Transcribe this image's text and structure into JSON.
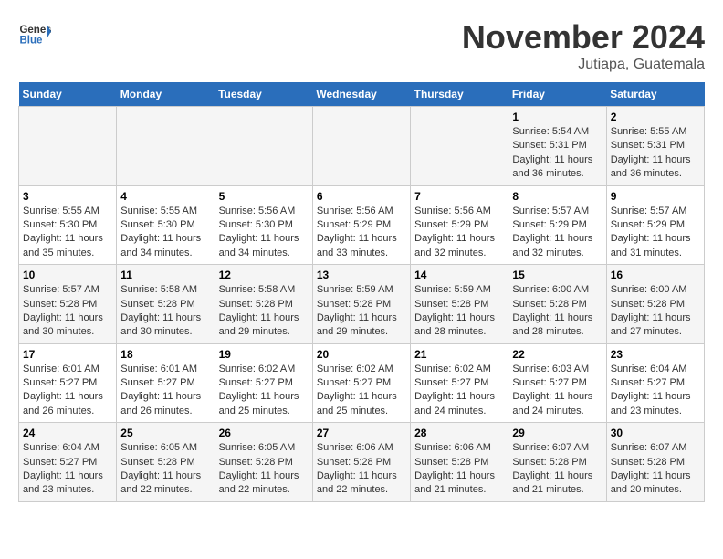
{
  "header": {
    "logo_line1": "General",
    "logo_line2": "Blue",
    "month_title": "November 2024",
    "location": "Jutiapa, Guatemala"
  },
  "weekdays": [
    "Sunday",
    "Monday",
    "Tuesday",
    "Wednesday",
    "Thursday",
    "Friday",
    "Saturday"
  ],
  "weeks": [
    [
      {
        "day": "",
        "info": ""
      },
      {
        "day": "",
        "info": ""
      },
      {
        "day": "",
        "info": ""
      },
      {
        "day": "",
        "info": ""
      },
      {
        "day": "",
        "info": ""
      },
      {
        "day": "1",
        "info": "Sunrise: 5:54 AM\nSunset: 5:31 PM\nDaylight: 11 hours and 36 minutes."
      },
      {
        "day": "2",
        "info": "Sunrise: 5:55 AM\nSunset: 5:31 PM\nDaylight: 11 hours and 36 minutes."
      }
    ],
    [
      {
        "day": "3",
        "info": "Sunrise: 5:55 AM\nSunset: 5:30 PM\nDaylight: 11 hours and 35 minutes."
      },
      {
        "day": "4",
        "info": "Sunrise: 5:55 AM\nSunset: 5:30 PM\nDaylight: 11 hours and 34 minutes."
      },
      {
        "day": "5",
        "info": "Sunrise: 5:56 AM\nSunset: 5:30 PM\nDaylight: 11 hours and 34 minutes."
      },
      {
        "day": "6",
        "info": "Sunrise: 5:56 AM\nSunset: 5:29 PM\nDaylight: 11 hours and 33 minutes."
      },
      {
        "day": "7",
        "info": "Sunrise: 5:56 AM\nSunset: 5:29 PM\nDaylight: 11 hours and 32 minutes."
      },
      {
        "day": "8",
        "info": "Sunrise: 5:57 AM\nSunset: 5:29 PM\nDaylight: 11 hours and 32 minutes."
      },
      {
        "day": "9",
        "info": "Sunrise: 5:57 AM\nSunset: 5:29 PM\nDaylight: 11 hours and 31 minutes."
      }
    ],
    [
      {
        "day": "10",
        "info": "Sunrise: 5:57 AM\nSunset: 5:28 PM\nDaylight: 11 hours and 30 minutes."
      },
      {
        "day": "11",
        "info": "Sunrise: 5:58 AM\nSunset: 5:28 PM\nDaylight: 11 hours and 30 minutes."
      },
      {
        "day": "12",
        "info": "Sunrise: 5:58 AM\nSunset: 5:28 PM\nDaylight: 11 hours and 29 minutes."
      },
      {
        "day": "13",
        "info": "Sunrise: 5:59 AM\nSunset: 5:28 PM\nDaylight: 11 hours and 29 minutes."
      },
      {
        "day": "14",
        "info": "Sunrise: 5:59 AM\nSunset: 5:28 PM\nDaylight: 11 hours and 28 minutes."
      },
      {
        "day": "15",
        "info": "Sunrise: 6:00 AM\nSunset: 5:28 PM\nDaylight: 11 hours and 28 minutes."
      },
      {
        "day": "16",
        "info": "Sunrise: 6:00 AM\nSunset: 5:28 PM\nDaylight: 11 hours and 27 minutes."
      }
    ],
    [
      {
        "day": "17",
        "info": "Sunrise: 6:01 AM\nSunset: 5:27 PM\nDaylight: 11 hours and 26 minutes."
      },
      {
        "day": "18",
        "info": "Sunrise: 6:01 AM\nSunset: 5:27 PM\nDaylight: 11 hours and 26 minutes."
      },
      {
        "day": "19",
        "info": "Sunrise: 6:02 AM\nSunset: 5:27 PM\nDaylight: 11 hours and 25 minutes."
      },
      {
        "day": "20",
        "info": "Sunrise: 6:02 AM\nSunset: 5:27 PM\nDaylight: 11 hours and 25 minutes."
      },
      {
        "day": "21",
        "info": "Sunrise: 6:02 AM\nSunset: 5:27 PM\nDaylight: 11 hours and 24 minutes."
      },
      {
        "day": "22",
        "info": "Sunrise: 6:03 AM\nSunset: 5:27 PM\nDaylight: 11 hours and 24 minutes."
      },
      {
        "day": "23",
        "info": "Sunrise: 6:04 AM\nSunset: 5:27 PM\nDaylight: 11 hours and 23 minutes."
      }
    ],
    [
      {
        "day": "24",
        "info": "Sunrise: 6:04 AM\nSunset: 5:27 PM\nDaylight: 11 hours and 23 minutes."
      },
      {
        "day": "25",
        "info": "Sunrise: 6:05 AM\nSunset: 5:28 PM\nDaylight: 11 hours and 22 minutes."
      },
      {
        "day": "26",
        "info": "Sunrise: 6:05 AM\nSunset: 5:28 PM\nDaylight: 11 hours and 22 minutes."
      },
      {
        "day": "27",
        "info": "Sunrise: 6:06 AM\nSunset: 5:28 PM\nDaylight: 11 hours and 22 minutes."
      },
      {
        "day": "28",
        "info": "Sunrise: 6:06 AM\nSunset: 5:28 PM\nDaylight: 11 hours and 21 minutes."
      },
      {
        "day": "29",
        "info": "Sunrise: 6:07 AM\nSunset: 5:28 PM\nDaylight: 11 hours and 21 minutes."
      },
      {
        "day": "30",
        "info": "Sunrise: 6:07 AM\nSunset: 5:28 PM\nDaylight: 11 hours and 20 minutes."
      }
    ]
  ]
}
